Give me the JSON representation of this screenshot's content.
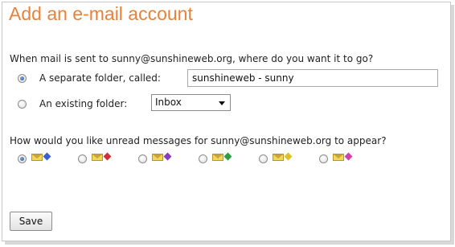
{
  "page": {
    "title": "Add an e-mail account",
    "question_destination": "When mail is sent to sunny@sunshineweb.org, where do you want it to go?",
    "question_appearance": "How would you like unread messages for sunny@sunshineweb.org to appear?"
  },
  "destination": {
    "separate_folder_label": "A separate folder, called:",
    "separate_folder_value": "sunshineweb - sunny",
    "separate_folder_selected": true,
    "existing_folder_label": "An existing folder:",
    "existing_folder_selected": false,
    "existing_folder_value": "Inbox"
  },
  "appearance": {
    "selected_index": 0,
    "options": [
      {
        "icon": "envelope-blue-flag-icon",
        "flag_color": "#3a5fd0"
      },
      {
        "icon": "envelope-red-flag-icon",
        "flag_color": "#d0303a"
      },
      {
        "icon": "envelope-purple-flag-icon",
        "flag_color": "#8a3ac0"
      },
      {
        "icon": "envelope-green-flag-icon",
        "flag_color": "#2aa040"
      },
      {
        "icon": "envelope-yellow-flag-icon",
        "flag_color": "#e0c020"
      },
      {
        "icon": "envelope-pink-flag-icon",
        "flag_color": "#d040b0"
      }
    ]
  },
  "actions": {
    "save_label": "Save"
  },
  "colors": {
    "title": "#e8823a"
  }
}
